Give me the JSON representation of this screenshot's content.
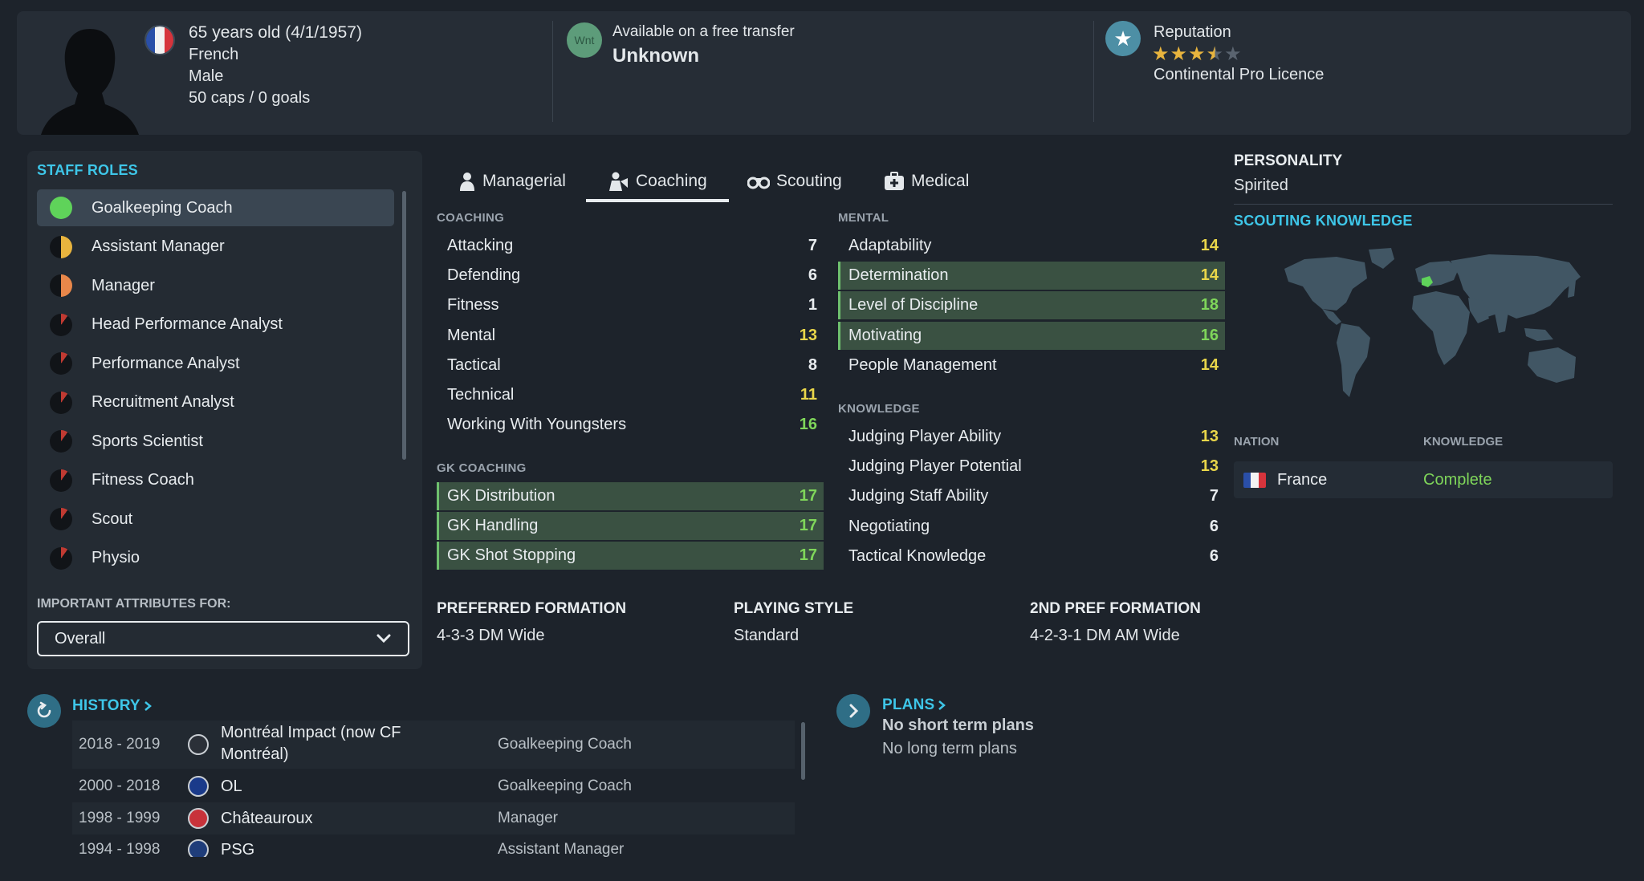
{
  "header": {
    "age_line": "65 years old (4/1/1957)",
    "nationality": "French",
    "gender": "Male",
    "caps_goals": "50 caps / 0 goals",
    "wnt_badge": "Wnt",
    "transfer_status": "Available on a free transfer",
    "transfer_value": "Unknown",
    "reputation_label": "Reputation",
    "reputation_stars": 3.5,
    "licence": "Continental Pro Licence"
  },
  "staff_roles": {
    "title": "STAFF ROLES",
    "items": [
      {
        "label": "Goalkeeping Coach",
        "color": "#5fd35a",
        "fill": 1.0
      },
      {
        "label": "Assistant Manager",
        "color": "#e8b43e",
        "fill": 0.5
      },
      {
        "label": "Manager",
        "color": "#e8874a",
        "fill": 0.5
      },
      {
        "label": "Head Performance Analyst",
        "color": "#c03a32",
        "fill": 0.1
      },
      {
        "label": "Performance Analyst",
        "color": "#c03a32",
        "fill": 0.1
      },
      {
        "label": "Recruitment Analyst",
        "color": "#c03a32",
        "fill": 0.1
      },
      {
        "label": "Sports Scientist",
        "color": "#c03a32",
        "fill": 0.1
      },
      {
        "label": "Fitness Coach",
        "color": "#c03a32",
        "fill": 0.1
      },
      {
        "label": "Scout",
        "color": "#c03a32",
        "fill": 0.1
      },
      {
        "label": "Physio",
        "color": "#c03a32",
        "fill": 0.1
      }
    ],
    "important_label": "IMPORTANT ATTRIBUTES FOR:",
    "important_value": "Overall"
  },
  "tabs": [
    {
      "label": "Managerial",
      "icon": "person-icon"
    },
    {
      "label": "Coaching",
      "icon": "coach-icon"
    },
    {
      "label": "Scouting",
      "icon": "binoculars-icon"
    },
    {
      "label": "Medical",
      "icon": "medical-kit-icon"
    }
  ],
  "coaching": {
    "title": "COACHING",
    "rows": [
      {
        "label": "Attacking",
        "value": 7,
        "hl": false
      },
      {
        "label": "Defending",
        "value": 6,
        "hl": false
      },
      {
        "label": "Fitness",
        "value": 1,
        "hl": false
      },
      {
        "label": "Mental",
        "value": 13,
        "hl": false
      },
      {
        "label": "Tactical",
        "value": 8,
        "hl": false
      },
      {
        "label": "Technical",
        "value": 11,
        "hl": false
      },
      {
        "label": "Working With Youngsters",
        "value": 16,
        "hl": false
      }
    ]
  },
  "gk_coaching": {
    "title": "GK COACHING",
    "rows": [
      {
        "label": "GK Distribution",
        "value": 17,
        "hl": true
      },
      {
        "label": "GK Handling",
        "value": 17,
        "hl": true
      },
      {
        "label": "GK Shot Stopping",
        "value": 17,
        "hl": true
      }
    ]
  },
  "mental": {
    "title": "MENTAL",
    "rows": [
      {
        "label": "Adaptability",
        "value": 14,
        "hl": false
      },
      {
        "label": "Determination",
        "value": 14,
        "hl": true
      },
      {
        "label": "Level of Discipline",
        "value": 18,
        "hl": true
      },
      {
        "label": "Motivating",
        "value": 16,
        "hl": true
      },
      {
        "label": "People Management",
        "value": 14,
        "hl": false
      }
    ]
  },
  "knowledge": {
    "title": "KNOWLEDGE",
    "rows": [
      {
        "label": "Judging Player Ability",
        "value": 13,
        "hl": false
      },
      {
        "label": "Judging Player Potential",
        "value": 13,
        "hl": false
      },
      {
        "label": "Judging Staff Ability",
        "value": 7,
        "hl": false
      },
      {
        "label": "Negotiating",
        "value": 6,
        "hl": false
      },
      {
        "label": "Tactical Knowledge",
        "value": 6,
        "hl": false
      }
    ]
  },
  "preferences": {
    "formation_title": "PREFERRED FORMATION",
    "formation": "4-3-3 DM Wide",
    "style_title": "PLAYING STYLE",
    "style": "Standard",
    "formation2_title": "2ND PREF FORMATION",
    "formation2": "4-2-3-1 DM AM Wide"
  },
  "personality": {
    "title": "PERSONALITY",
    "value": "Spirited"
  },
  "scouting_knowledge": {
    "title": "SCOUTING KNOWLEDGE",
    "nation_header": "NATION",
    "knowledge_header": "KNOWLEDGE",
    "rows": [
      {
        "nation": "France",
        "knowledge": "Complete"
      }
    ]
  },
  "history": {
    "title": "HISTORY",
    "rows": [
      {
        "years": "2018 - 2019",
        "club": "Montréal Impact (now CF Montréal)",
        "role": "Goalkeeping Coach"
      },
      {
        "years": "2000 - 2018",
        "club": "OL",
        "role": "Goalkeeping Coach"
      },
      {
        "years": "1998 - 1999",
        "club": "Châteauroux",
        "role": "Manager"
      },
      {
        "years": "1994 - 1998",
        "club": "PSG",
        "role": "Assistant Manager"
      }
    ]
  },
  "plans": {
    "title": "PLANS",
    "short_term": "No short term plans",
    "long_term": "No long term plans"
  },
  "colors": {
    "accent": "#3ec6e8",
    "highlight_row": "#3a5142",
    "value_high": "#7fd65a",
    "value_mid": "#e9d64a",
    "star": "#e8b43e"
  }
}
